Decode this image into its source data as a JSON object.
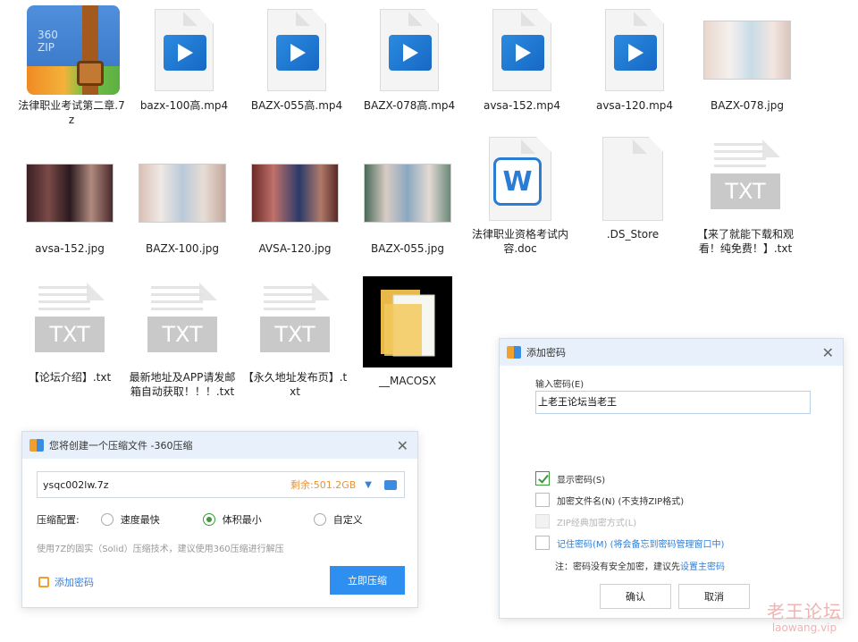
{
  "files": [
    {
      "id": "zip",
      "name": "法律职业考试第二章.7z",
      "type": "zip",
      "icon": "zip-archive-icon",
      "badge": "360\nZIP"
    },
    {
      "id": "v1",
      "name": "bazx-100高.mp4",
      "type": "video",
      "icon": "video-file-icon"
    },
    {
      "id": "v2",
      "name": "BAZX-055高.mp4",
      "type": "video",
      "icon": "video-file-icon"
    },
    {
      "id": "v3",
      "name": "BAZX-078高.mp4",
      "type": "video",
      "icon": "video-file-icon"
    },
    {
      "id": "v4",
      "name": "avsa-152.mp4",
      "type": "video",
      "icon": "video-file-icon"
    },
    {
      "id": "v5",
      "name": "avsa-120.mp4",
      "type": "video",
      "icon": "video-file-icon"
    },
    {
      "id": "p1",
      "name": "BAZX-078.jpg",
      "type": "image",
      "icon": "image-thumbnail"
    },
    {
      "id": "p2",
      "name": "avsa-152.jpg",
      "type": "image",
      "icon": "image-thumbnail"
    },
    {
      "id": "p3",
      "name": "BAZX-100.jpg",
      "type": "image",
      "icon": "image-thumbnail"
    },
    {
      "id": "p4",
      "name": "AVSA-120.jpg",
      "type": "image",
      "icon": "image-thumbnail"
    },
    {
      "id": "p5",
      "name": "BAZX-055.jpg",
      "type": "image",
      "icon": "image-thumbnail"
    },
    {
      "id": "d1",
      "name": "法律职业资格考试内容.doc",
      "type": "word",
      "icon": "word-doc-icon",
      "badge": "W"
    },
    {
      "id": "d2",
      "name": ".DS_Store",
      "type": "blank",
      "icon": "blank-file-icon"
    },
    {
      "id": "t1",
      "name": "【来了就能下载和观看！纯免费！】.txt",
      "type": "txt",
      "icon": "txt-file-icon",
      "badge": "TXT"
    },
    {
      "id": "t2",
      "name": "【论坛介绍】.txt",
      "type": "txt",
      "icon": "txt-file-icon",
      "badge": "TXT"
    },
    {
      "id": "t3",
      "name": "最新地址及APP请发邮箱自动获取！！！.txt",
      "type": "txt",
      "icon": "txt-file-icon",
      "badge": "TXT"
    },
    {
      "id": "t4",
      "name": "【永久地址发布页】.txt",
      "type": "txt",
      "icon": "txt-file-icon",
      "badge": "TXT"
    },
    {
      "id": "f1",
      "name": "__MACOSX",
      "type": "folder",
      "icon": "folder-icon"
    }
  ],
  "compress_dialog": {
    "title": "您将创建一个压缩文件 -360压缩",
    "filename": "ysqc002lw.7z",
    "space_left": "剩余:501.2GB",
    "config_label": "压缩配置:",
    "options": [
      "速度最快",
      "体积最小",
      "自定义"
    ],
    "selected_option": "体积最小",
    "hint": "使用7Z的固实（Solid）压缩技术，建议使用360压缩进行解压",
    "add_password": "添加密码",
    "start_button": "立即压缩"
  },
  "password_dialog": {
    "title": "添加密码",
    "input_label": "输入密码(E)",
    "password_value": "上老王论坛当老王",
    "show_password": "显示密码(S)",
    "show_password_checked": true,
    "encrypt_filenames": "加密文件名(N) (不支持ZIP格式)",
    "zip_classic": "ZIP经典加密方式(L)",
    "remember": "记住密码(M) (将会备忘到密码管理窗口中)",
    "note_prefix": "注：密码没有安全加密，建议先",
    "note_link": "设置主密码",
    "ok": "确认",
    "cancel": "取消"
  },
  "watermark": {
    "line1": "老王论坛",
    "line2": "laowang.vip"
  },
  "colors": {
    "accent": "#2e8ff0",
    "selected": "#3a9a3a",
    "warning": "#e6943a"
  }
}
